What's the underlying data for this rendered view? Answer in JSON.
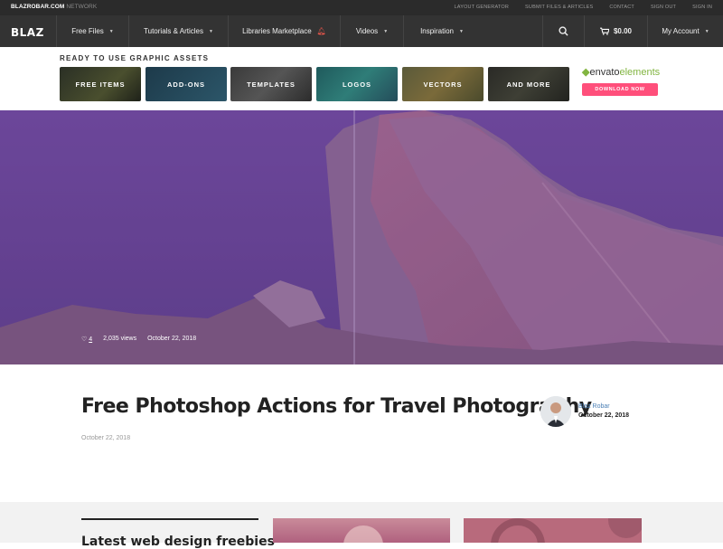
{
  "topbar": {
    "network_brand": "BLAZROBAR.COM",
    "network_suffix": "NETWORK",
    "links": [
      "LAYOUT GENERATOR",
      "SUBMIT FILES & ARTICLES",
      "CONTACT",
      "SIGN OUT",
      "SIGN IN"
    ]
  },
  "nav": {
    "logo": "BLAZ",
    "items": [
      {
        "label": "Free Files"
      },
      {
        "label": "Tutorials & Articles"
      },
      {
        "label": "Libraries Marketplace"
      },
      {
        "label": "Videos"
      },
      {
        "label": "Inspiration"
      }
    ],
    "cart_total": "$0.00",
    "account": "My Account"
  },
  "assets": {
    "heading": "READY TO USE GRAPHIC ASSETS",
    "tiles": [
      "FREE ITEMS",
      "ADD-ONS",
      "TEMPLATES",
      "LOGOS",
      "VECTORS",
      "AND MORE"
    ],
    "envato_brand_a": "envato",
    "envato_brand_b": "elements",
    "download_label": "DOWNLOAD NOW"
  },
  "hero": {
    "likes": "4",
    "views": "2,035 views",
    "date": "October 22, 2018"
  },
  "article": {
    "title": "Free Photoshop Actions for Travel Photography",
    "date": "October 22, 2018",
    "author": "Blaz Robar",
    "author_date": "October 22, 2018"
  },
  "latest": {
    "heading": "Latest web design freebies"
  }
}
